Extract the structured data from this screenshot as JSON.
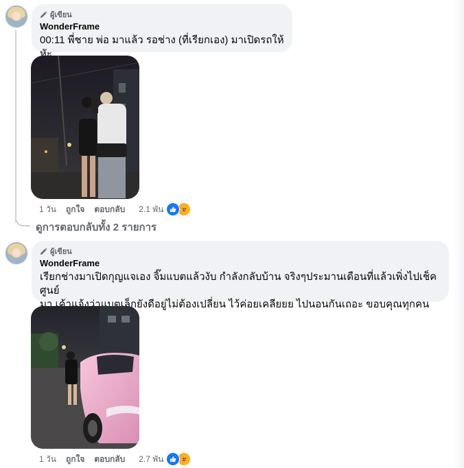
{
  "comments": [
    {
      "badge": "ผู้เขียน",
      "author": "WonderFrame",
      "text": "00:11 พี่ชาย พ่อ มาแล้ว รอช่าง (ที่เรียกเอง) มาเปิดรถให้หัะ",
      "time": "1 วัน",
      "like_label": "ถูกใจ",
      "reply_label": "ตอบกลับ",
      "reaction_count": "2.1 พัน"
    },
    {
      "badge": "ผู้เขียน",
      "author": "WonderFrame",
      "text_line1": "เรียกช่างมาเปิดกุญแจเอง จิ๊มแบตแล้วงับ กำลังกลับบ้าน จริงๆประมานเดือนที่แล้วเพิ่งไปเช็คศูนย์",
      "text_line2": "มา เค้าแจ้งว่าแบตเล็กยังดีอยู่ไม่ต้องเปลี่ยน ไว้ค่อยเคลียยย ไปนอนกันเถอะ ขอบคุณทุกคนน้า🫶🏻",
      "time": "1 วัน",
      "like_label": "ถูกใจ",
      "reply_label": "ตอบกลับ",
      "reaction_count": "2.7 พัน"
    }
  ],
  "view_replies": "ดูการตอบกลับทั้ง 2 รายการ",
  "icons": {
    "badge": "pencil-icon",
    "reaction_1": "like-reaction-icon",
    "reaction_2": "care-reaction-icon"
  },
  "colors": {
    "bubble": "#f0f2f5",
    "secondary_text": "#65676b",
    "like_blue": "#1877f2",
    "care_yellow": "#f7b125"
  }
}
